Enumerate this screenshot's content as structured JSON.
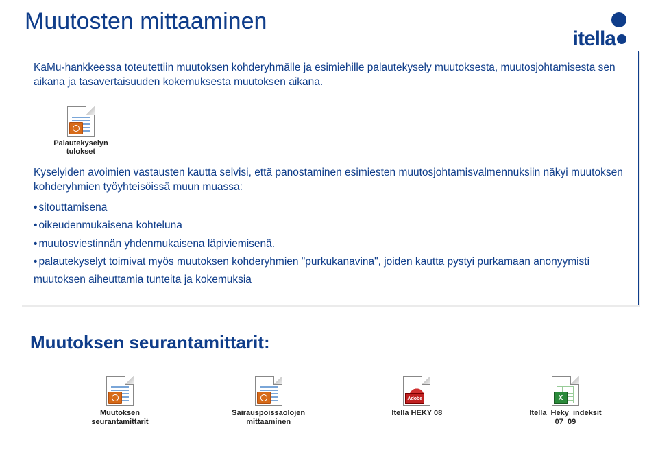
{
  "title": "Muutosten mittaaminen",
  "logo": {
    "text": "itella"
  },
  "intro": "KaMu-hankkeessa toteutettiin muutoksen kohderyhmälle ja esimiehille palautekysely muutoksesta, muutosjohtamisesta sen aikana ja tasavertaisuuden kokemuksesta muutoksen aikana.",
  "file1": {
    "caption_l1": "Palautekyselyn",
    "caption_l2": "tulokset"
  },
  "body1": "Kyselyiden avoimien vastausten kautta selvisi, että panostaminen esimiesten muutosjohtamisvalmennuksiin näkyi muutoksen kohderyhmien työyhteisöissä muun muassa:",
  "bullets": [
    "sitouttamisena",
    "oikeudenmukaisena kohteluna",
    "muutosviestinnän yhdenmukaisena läpiviemisenä."
  ],
  "body2": "palautekyselyt toimivat myös muutoksen kohderyhmien \"purkukanavina\", joiden kautta pystyi purkamaan anonyymisti muutoksen aiheuttamia tunteita ja kokemuksia",
  "section_heading": "Muutoksen seurantamittarit:",
  "row_files": [
    {
      "l1": "Muutoksen",
      "l2": "seurantamittarit",
      "type": "ppt"
    },
    {
      "l1": "Sairauspoissaolojen",
      "l2": "mittaaminen",
      "type": "ppt"
    },
    {
      "l1": "Itella HEKY 08",
      "l2": "",
      "type": "pdf"
    },
    {
      "l1": "Itella_Heky_indeksit",
      "l2": "07_09",
      "type": "xls"
    }
  ],
  "pdf_label": "Adobe"
}
